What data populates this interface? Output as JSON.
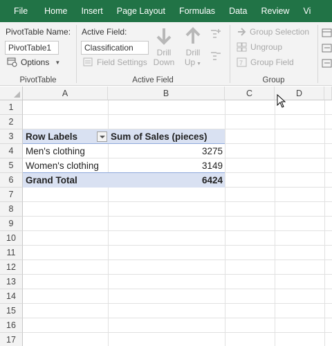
{
  "menu": {
    "tabs": [
      "File",
      "Home",
      "Insert",
      "Page Layout",
      "Formulas",
      "Data",
      "Review",
      "Vi"
    ]
  },
  "ribbon": {
    "pivottable_group": {
      "name_label": "PivotTable Name:",
      "name_value": "PivotTable1",
      "options_label": "Options",
      "group_label": "PivotTable"
    },
    "active_field_group": {
      "field_label": "Active Field:",
      "field_value": "Classification",
      "field_settings_label": "Field Settings",
      "drill_down_line1": "Drill",
      "drill_down_line2": "Down",
      "drill_up_line1": "Drill",
      "drill_up_line2": "Up",
      "group_label": "Active Field"
    },
    "group_group": {
      "group_selection_label": "Group Selection",
      "ungroup_label": "Ungroup",
      "group_field_label": "Group Field",
      "group_label": "Group"
    }
  },
  "sheet": {
    "columns": [
      "A",
      "B",
      "C",
      "D"
    ],
    "rows": [
      "1",
      "2",
      "3",
      "4",
      "5",
      "6",
      "7",
      "8",
      "9",
      "10",
      "11",
      "12",
      "13",
      "14",
      "15",
      "16",
      "17"
    ],
    "pivot": {
      "row_labels_header": "Row Labels",
      "value_header": "Sum of Sales (pieces)",
      "items": [
        {
          "label": "Men's clothing",
          "value": "3275"
        },
        {
          "label": "Women's clothing",
          "value": "3149"
        }
      ],
      "grand_total_label": "Grand Total",
      "grand_total_value": "6424"
    }
  },
  "colors": {
    "menubar": "#217346",
    "pivot_header_fill": "#d9e1f2",
    "pivot_border": "#8ea9db"
  }
}
